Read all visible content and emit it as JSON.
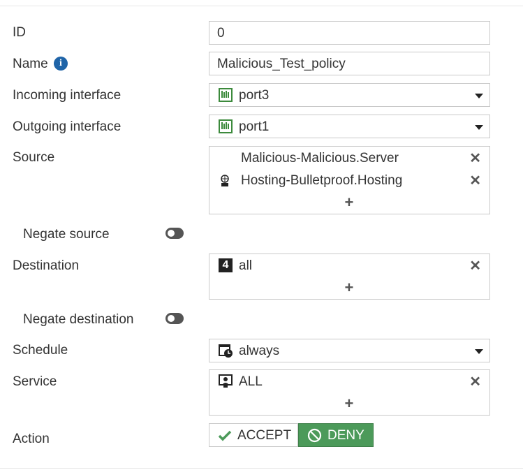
{
  "fields": {
    "id": {
      "label": "ID",
      "value": "0"
    },
    "name": {
      "label": "Name",
      "value": "Malicious_Test_policy",
      "info_icon": "i"
    },
    "incoming_interface": {
      "label": "Incoming interface",
      "value": "port3",
      "icon": "interface-port-icon"
    },
    "outgoing_interface": {
      "label": "Outgoing interface",
      "value": "port1",
      "icon": "interface-port-icon"
    },
    "source": {
      "label": "Source",
      "items": [
        "Malicious-Malicious.Server",
        "Hosting-Bulletproof.Hosting"
      ],
      "add": "+",
      "remove": "✕"
    },
    "negate_source": {
      "label": "Negate source"
    },
    "destination": {
      "label": "Destination",
      "items": [
        "all"
      ],
      "add": "+",
      "remove": "✕",
      "icon_text": "4"
    },
    "negate_destination": {
      "label": "Negate destination"
    },
    "schedule": {
      "label": "Schedule",
      "value": "always"
    },
    "service": {
      "label": "Service",
      "items": [
        "ALL"
      ],
      "add": "+",
      "remove": "✕"
    },
    "action": {
      "label": "Action",
      "accept": "ACCEPT",
      "deny": "DENY",
      "selected": "DENY"
    }
  },
  "colors": {
    "deny_bg": "#4c9a5a",
    "info_icon": "#1f64a8",
    "interface_icon": "#3c8a3c",
    "toggle": "#555555"
  }
}
